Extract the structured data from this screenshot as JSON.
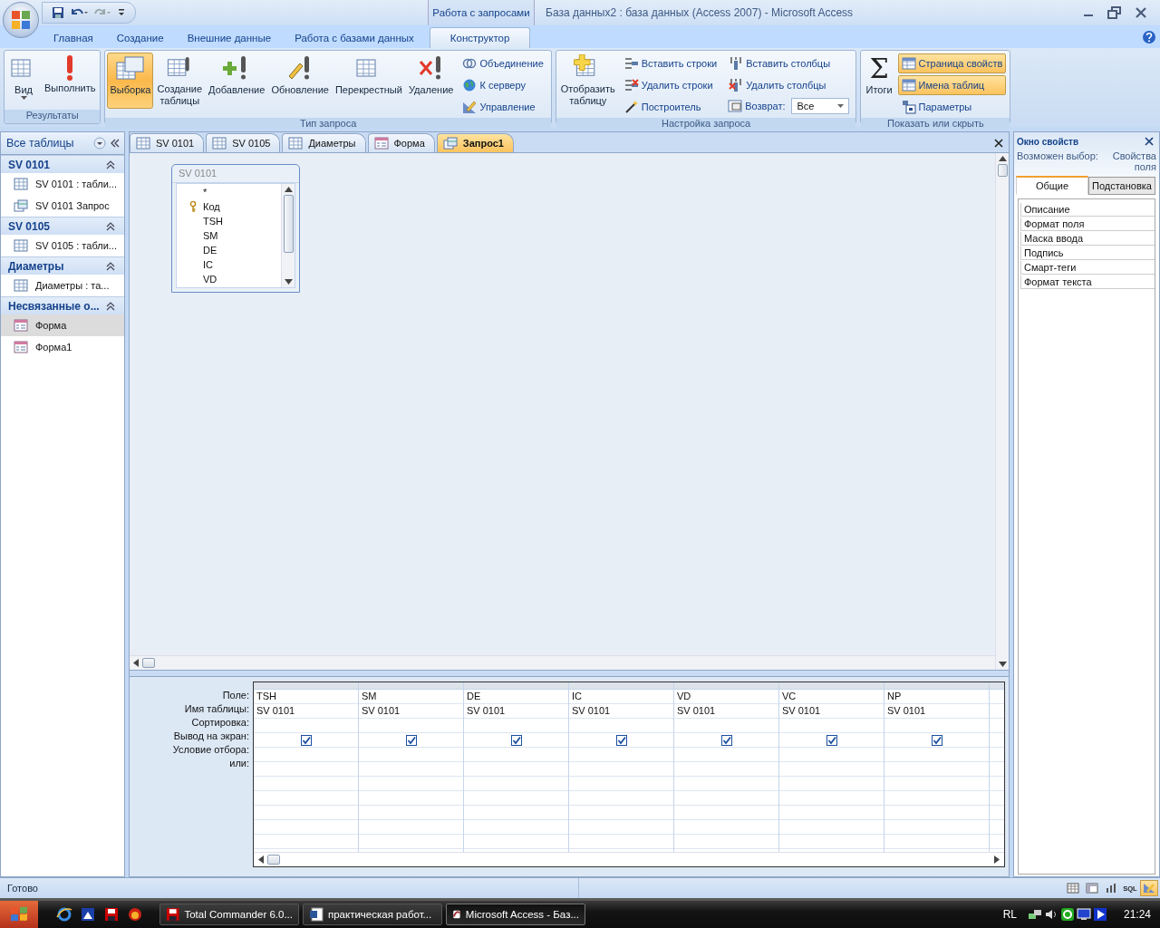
{
  "window": {
    "title": "База данных2 : база данных (Access 2007) - Microsoft Access",
    "context_tab": "Работа с запросами"
  },
  "ribbon_tabs": [
    {
      "label": "Главная",
      "selected": false
    },
    {
      "label": "Создание",
      "selected": false
    },
    {
      "label": "Внешние данные",
      "selected": false
    },
    {
      "label": "Работа с базами данных",
      "selected": false
    },
    {
      "label": "Конструктор",
      "selected": true
    }
  ],
  "ribbon_groups": [
    {
      "label": "Результаты",
      "items": [
        {
          "kind": "large",
          "label": "Вид",
          "dropdown": true,
          "selected": false
        },
        {
          "kind": "large",
          "label": "Выполнить",
          "selected": false
        }
      ]
    },
    {
      "label": "Тип запроса",
      "items": [
        {
          "kind": "large",
          "label": "Выборка",
          "selected": true
        },
        {
          "kind": "large",
          "label": "Создание таблицы",
          "selected": false
        },
        {
          "kind": "large",
          "label": "Добавление",
          "selected": false
        },
        {
          "kind": "large",
          "label": "Обновление",
          "selected": false
        },
        {
          "kind": "large",
          "label": "Перекрестный",
          "selected": false
        },
        {
          "kind": "large",
          "label": "Удаление",
          "selected": false
        },
        {
          "kind": "stack",
          "items": [
            {
              "kind": "small",
              "label": "Объединение",
              "selected": false
            },
            {
              "kind": "small",
              "label": "К серверу",
              "selected": false
            },
            {
              "kind": "small",
              "label": "Управление",
              "selected": false
            }
          ]
        }
      ]
    },
    {
      "label": "Настройка запроса",
      "items": [
        {
          "kind": "large",
          "label": "Отобразить таблицу",
          "selected": false
        },
        {
          "kind": "stack",
          "items": [
            {
              "kind": "small",
              "label": "Вставить строки",
              "selected": false
            },
            {
              "kind": "small",
              "label": "Удалить строки",
              "selected": false
            },
            {
              "kind": "small",
              "label": "Построитель",
              "selected": false
            }
          ]
        },
        {
          "kind": "stack",
          "items": [
            {
              "kind": "small",
              "label": "Вставить столбцы",
              "selected": false
            },
            {
              "kind": "small",
              "label": "Удалить столбцы",
              "selected": false
            },
            {
              "kind": "combo",
              "label": "Возврат:",
              "value": "Все"
            }
          ]
        }
      ]
    },
    {
      "label": "Показать или скрыть",
      "items": [
        {
          "kind": "large",
          "label": "Итоги",
          "glyph": "Σ",
          "selected": false
        },
        {
          "kind": "stack",
          "items": [
            {
              "kind": "small",
              "label": "Страница свойств",
              "selected": true
            },
            {
              "kind": "small",
              "label": "Имена таблиц",
              "selected": true
            },
            {
              "kind": "small",
              "label": "Параметры",
              "selected": false
            }
          ]
        }
      ]
    }
  ],
  "nav_pane": {
    "title": "Все таблицы",
    "groups": [
      {
        "title": "SV 0101",
        "items": [
          {
            "label": "SV 0101 : табли...",
            "kind": "table",
            "selected": false
          },
          {
            "label": "SV 0101 Запрос",
            "kind": "query",
            "selected": false
          }
        ]
      },
      {
        "title": "SV 0105",
        "items": [
          {
            "label": "SV 0105 : табли...",
            "kind": "table",
            "selected": false
          }
        ]
      },
      {
        "title": "Диаметры",
        "items": [
          {
            "label": "Диаметры : та...",
            "kind": "table",
            "selected": false
          }
        ]
      },
      {
        "title": "Несвязанные о...",
        "items": [
          {
            "label": "Форма",
            "kind": "form",
            "selected": true
          },
          {
            "label": "Форма1",
            "kind": "form",
            "selected": false
          }
        ]
      }
    ]
  },
  "doc_tabs": [
    {
      "label": "SV 0101",
      "kind": "table",
      "selected": false
    },
    {
      "label": "SV 0105",
      "kind": "table",
      "selected": false
    },
    {
      "label": "Диаметры",
      "kind": "table",
      "selected": false
    },
    {
      "label": "Форма",
      "kind": "form",
      "selected": false
    },
    {
      "label": "Запрос1",
      "kind": "query",
      "selected": true
    }
  ],
  "field_list": {
    "title": "SV 0101",
    "fields": [
      {
        "name": "*",
        "key": false
      },
      {
        "name": "Код",
        "key": true
      },
      {
        "name": "TSH",
        "key": false
      },
      {
        "name": "SM",
        "key": false
      },
      {
        "name": "DE",
        "key": false
      },
      {
        "name": "IC",
        "key": false
      },
      {
        "name": "VD",
        "key": false
      }
    ]
  },
  "design_grid": {
    "row_labels": [
      "Поле:",
      "Имя таблицы:",
      "Сортировка:",
      "Вывод на экран:",
      "Условие отбора:",
      "или:"
    ],
    "columns": [
      {
        "field": "TSH",
        "table": "SV 0101",
        "show": true
      },
      {
        "field": "SM",
        "table": "SV 0101",
        "show": true
      },
      {
        "field": "DE",
        "table": "SV 0101",
        "show": true
      },
      {
        "field": "IC",
        "table": "SV 0101",
        "show": true
      },
      {
        "field": "VD",
        "table": "SV 0101",
        "show": true
      },
      {
        "field": "VC",
        "table": "SV 0101",
        "show": true
      },
      {
        "field": "NP",
        "table": "SV 0101",
        "show": true
      }
    ]
  },
  "property_sheet": {
    "title": "Окно свойств",
    "selection_label": "Возможен выбор:",
    "selection": "Свойства поля",
    "tabs": [
      {
        "label": "Общие",
        "selected": true
      },
      {
        "label": "Подстановка",
        "selected": false
      }
    ],
    "properties": [
      "Описание",
      "Формат поля",
      "Маска ввода",
      "Подпись",
      "Смарт-теги",
      "Формат текста"
    ]
  },
  "status_bar": {
    "text": "Готово",
    "view_buttons": [
      {
        "kind": "datasheet",
        "selected": false
      },
      {
        "kind": "pivot",
        "selected": false
      },
      {
        "kind": "chart",
        "selected": false
      },
      {
        "kind": "sql",
        "label": "SQL",
        "selected": false
      },
      {
        "kind": "design",
        "selected": true
      }
    ]
  },
  "taskbar": {
    "tasks": [
      {
        "label": "Total Commander 6.0...",
        "kind": "commander",
        "selected": false
      },
      {
        "label": "практическая работ...",
        "kind": "word",
        "selected": false
      },
      {
        "label": "Microsoft Access - Баз...",
        "kind": "access",
        "selected": true
      }
    ],
    "language": "RL",
    "clock": "21:24"
  }
}
